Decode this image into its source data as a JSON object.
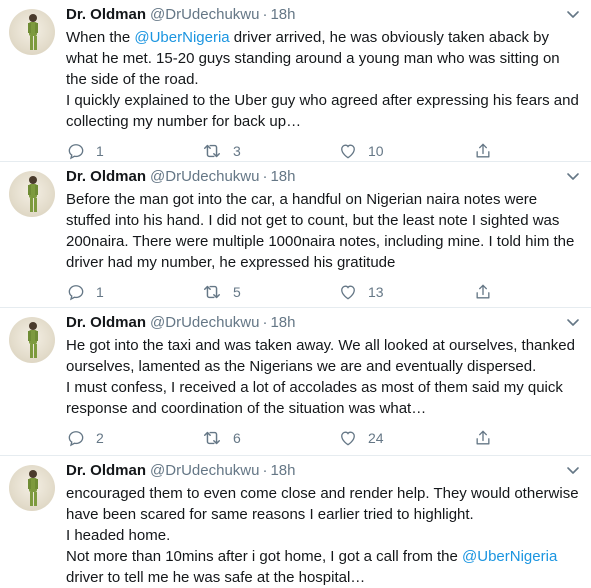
{
  "tweets": [
    {
      "name": "Dr. Oldman",
      "handle": "@DrUdechukwu",
      "dot": "·",
      "time": "18h",
      "text_before_mention": "When the ",
      "mention": "@UberNigeria",
      "text_after_mention": " driver arrived, he was obviously taken aback by what he met. 15-20 guys standing around a young man who was sitting on the side of the road.\nI quickly explained to the Uber guy who agreed after expressing his fears and collecting my number for back up…",
      "replies": "1",
      "retweets": "3",
      "likes": "10"
    },
    {
      "name": "Dr. Oldman",
      "handle": "@DrUdechukwu",
      "dot": "·",
      "time": "18h",
      "text": "Before the man got into the car, a handful on Nigerian naira notes were stuffed into his hand. I did not get to count, but the least note I sighted was 200naira. There were multiple 1000naira notes, including mine. I told him the driver had my number, he expressed his gratitude",
      "replies": "1",
      "retweets": "5",
      "likes": "13"
    },
    {
      "name": "Dr. Oldman",
      "handle": "@DrUdechukwu",
      "dot": "·",
      "time": "18h",
      "text": "He got into the taxi and was taken away. We all looked at ourselves, thanked ourselves, lamented as the Nigerians we are and eventually dispersed.\nI must confess, I received a lot of accolades as most of them said my quick response and coordination of the situation was what…",
      "replies": "2",
      "retweets": "6",
      "likes": "24"
    },
    {
      "name": "Dr. Oldman",
      "handle": "@DrUdechukwu",
      "dot": "·",
      "time": "18h",
      "text_before_mention": "encouraged them to even come close and render help. They would otherwise have been scared for same reasons I earlier tried to highlight.\nI headed home.\nNot more than 10mins after i got home, I got a call from the ",
      "mention": "@UberNigeria",
      "text_after_mention": " driver to tell me he was safe at the hospital…"
    }
  ],
  "colors": {
    "text": "#14171a",
    "secondary": "#657786",
    "link": "#1b95e0",
    "border": "#e6ecf0"
  },
  "icons": {
    "reply": "reply-icon",
    "retweet": "retweet-icon",
    "like": "heart-icon",
    "share": "share-icon",
    "more": "chevron-down-icon"
  }
}
